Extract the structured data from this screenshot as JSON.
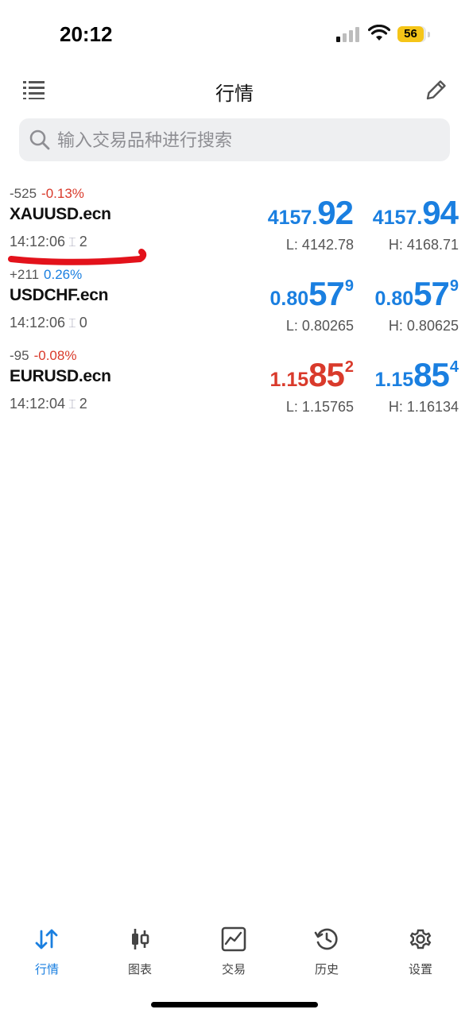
{
  "status_bar": {
    "time": "20:12",
    "battery": "56"
  },
  "header": {
    "title": "行情"
  },
  "search": {
    "placeholder": "输入交易品种进行搜索"
  },
  "quotes": [
    {
      "change_points": "-525",
      "change_percent": "-0.13%",
      "direction": "down",
      "symbol": "XAUUSD.ecn",
      "time": "14:12:06",
      "spread": "2",
      "bid": {
        "small": "4157.",
        "big": "92",
        "pip": "",
        "color": "up"
      },
      "ask": {
        "small": "4157.",
        "big": "94",
        "pip": "",
        "color": "up"
      },
      "low": "L: 4142.78",
      "high": "H: 4168.71"
    },
    {
      "change_points": "+211",
      "change_percent": "0.26%",
      "direction": "up",
      "symbol": "USDCHF.ecn",
      "time": "14:12:06",
      "spread": "0",
      "bid": {
        "small": "0.80",
        "big": "57",
        "pip": "9",
        "color": "up"
      },
      "ask": {
        "small": "0.80",
        "big": "57",
        "pip": "9",
        "color": "up"
      },
      "low": "L: 0.80265",
      "high": "H: 0.80625"
    },
    {
      "change_points": "-95",
      "change_percent": "-0.08%",
      "direction": "down",
      "symbol": "EURUSD.ecn",
      "time": "14:12:04",
      "spread": "2",
      "bid": {
        "small": "1.15",
        "big": "85",
        "pip": "2",
        "color": "down"
      },
      "ask": {
        "small": "1.15",
        "big": "85",
        "pip": "4",
        "color": "up"
      },
      "low": "L: 1.15765",
      "high": "H: 1.16134"
    }
  ],
  "tabs": [
    {
      "label": "行情",
      "icon": "quotes-icon",
      "active": true
    },
    {
      "label": "图表",
      "icon": "chart-icon",
      "active": false
    },
    {
      "label": "交易",
      "icon": "trade-icon",
      "active": false
    },
    {
      "label": "历史",
      "icon": "history-icon",
      "active": false
    },
    {
      "label": "设置",
      "icon": "settings-icon",
      "active": false
    }
  ],
  "colors": {
    "up": "#1a7fe0",
    "down": "#d93a2b",
    "marker": "#e3121b"
  }
}
